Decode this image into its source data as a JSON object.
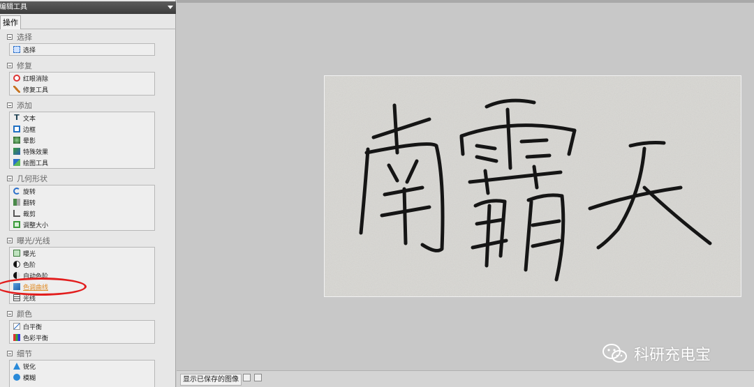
{
  "sidebar": {
    "title": "编辑工具",
    "tab": "操作",
    "sections": [
      {
        "title": "选择",
        "items": [
          {
            "label": "选择",
            "icon": "select-icon"
          }
        ]
      },
      {
        "title": "修复",
        "items": [
          {
            "label": "红眼消除",
            "icon": "red-eye-icon"
          },
          {
            "label": "修复工具",
            "icon": "repair-brush-icon"
          }
        ]
      },
      {
        "title": "添加",
        "items": [
          {
            "label": "文本",
            "icon": "text-icon"
          },
          {
            "label": "边框",
            "icon": "border-icon"
          },
          {
            "label": "晕影",
            "icon": "vignette-icon"
          },
          {
            "label": "特殊效果",
            "icon": "special-effects-icon"
          },
          {
            "label": "绘图工具",
            "icon": "draw-tool-icon"
          }
        ]
      },
      {
        "title": "几何形状",
        "items": [
          {
            "label": "旋转",
            "icon": "rotate-icon"
          },
          {
            "label": "翻转",
            "icon": "flip-icon"
          },
          {
            "label": "裁剪",
            "icon": "crop-icon"
          },
          {
            "label": "调整大小",
            "icon": "resize-icon"
          }
        ]
      },
      {
        "title": "曝光/光线",
        "items": [
          {
            "label": "曝光",
            "icon": "exposure-icon"
          },
          {
            "label": "色阶",
            "icon": "levels-icon"
          },
          {
            "label": "自动色阶",
            "icon": "auto-levels-icon"
          },
          {
            "label": "色调曲线",
            "icon": "curves-icon",
            "highlight": true
          },
          {
            "label": "光线",
            "icon": "light-icon"
          }
        ]
      },
      {
        "title": "颜色",
        "items": [
          {
            "label": "白平衡",
            "icon": "white-balance-icon"
          },
          {
            "label": "色彩平衡",
            "icon": "color-balance-icon"
          }
        ]
      },
      {
        "title": "细节",
        "items": [
          {
            "label": "锐化",
            "icon": "sharpen-icon"
          },
          {
            "label": "模糊",
            "icon": "blur-icon"
          }
        ]
      }
    ]
  },
  "status": {
    "label": "显示已保存的图像"
  },
  "watermark": "科研充电宝",
  "colors": {
    "annotation": "#e21d1d",
    "highlight_text": "#e08a22"
  }
}
